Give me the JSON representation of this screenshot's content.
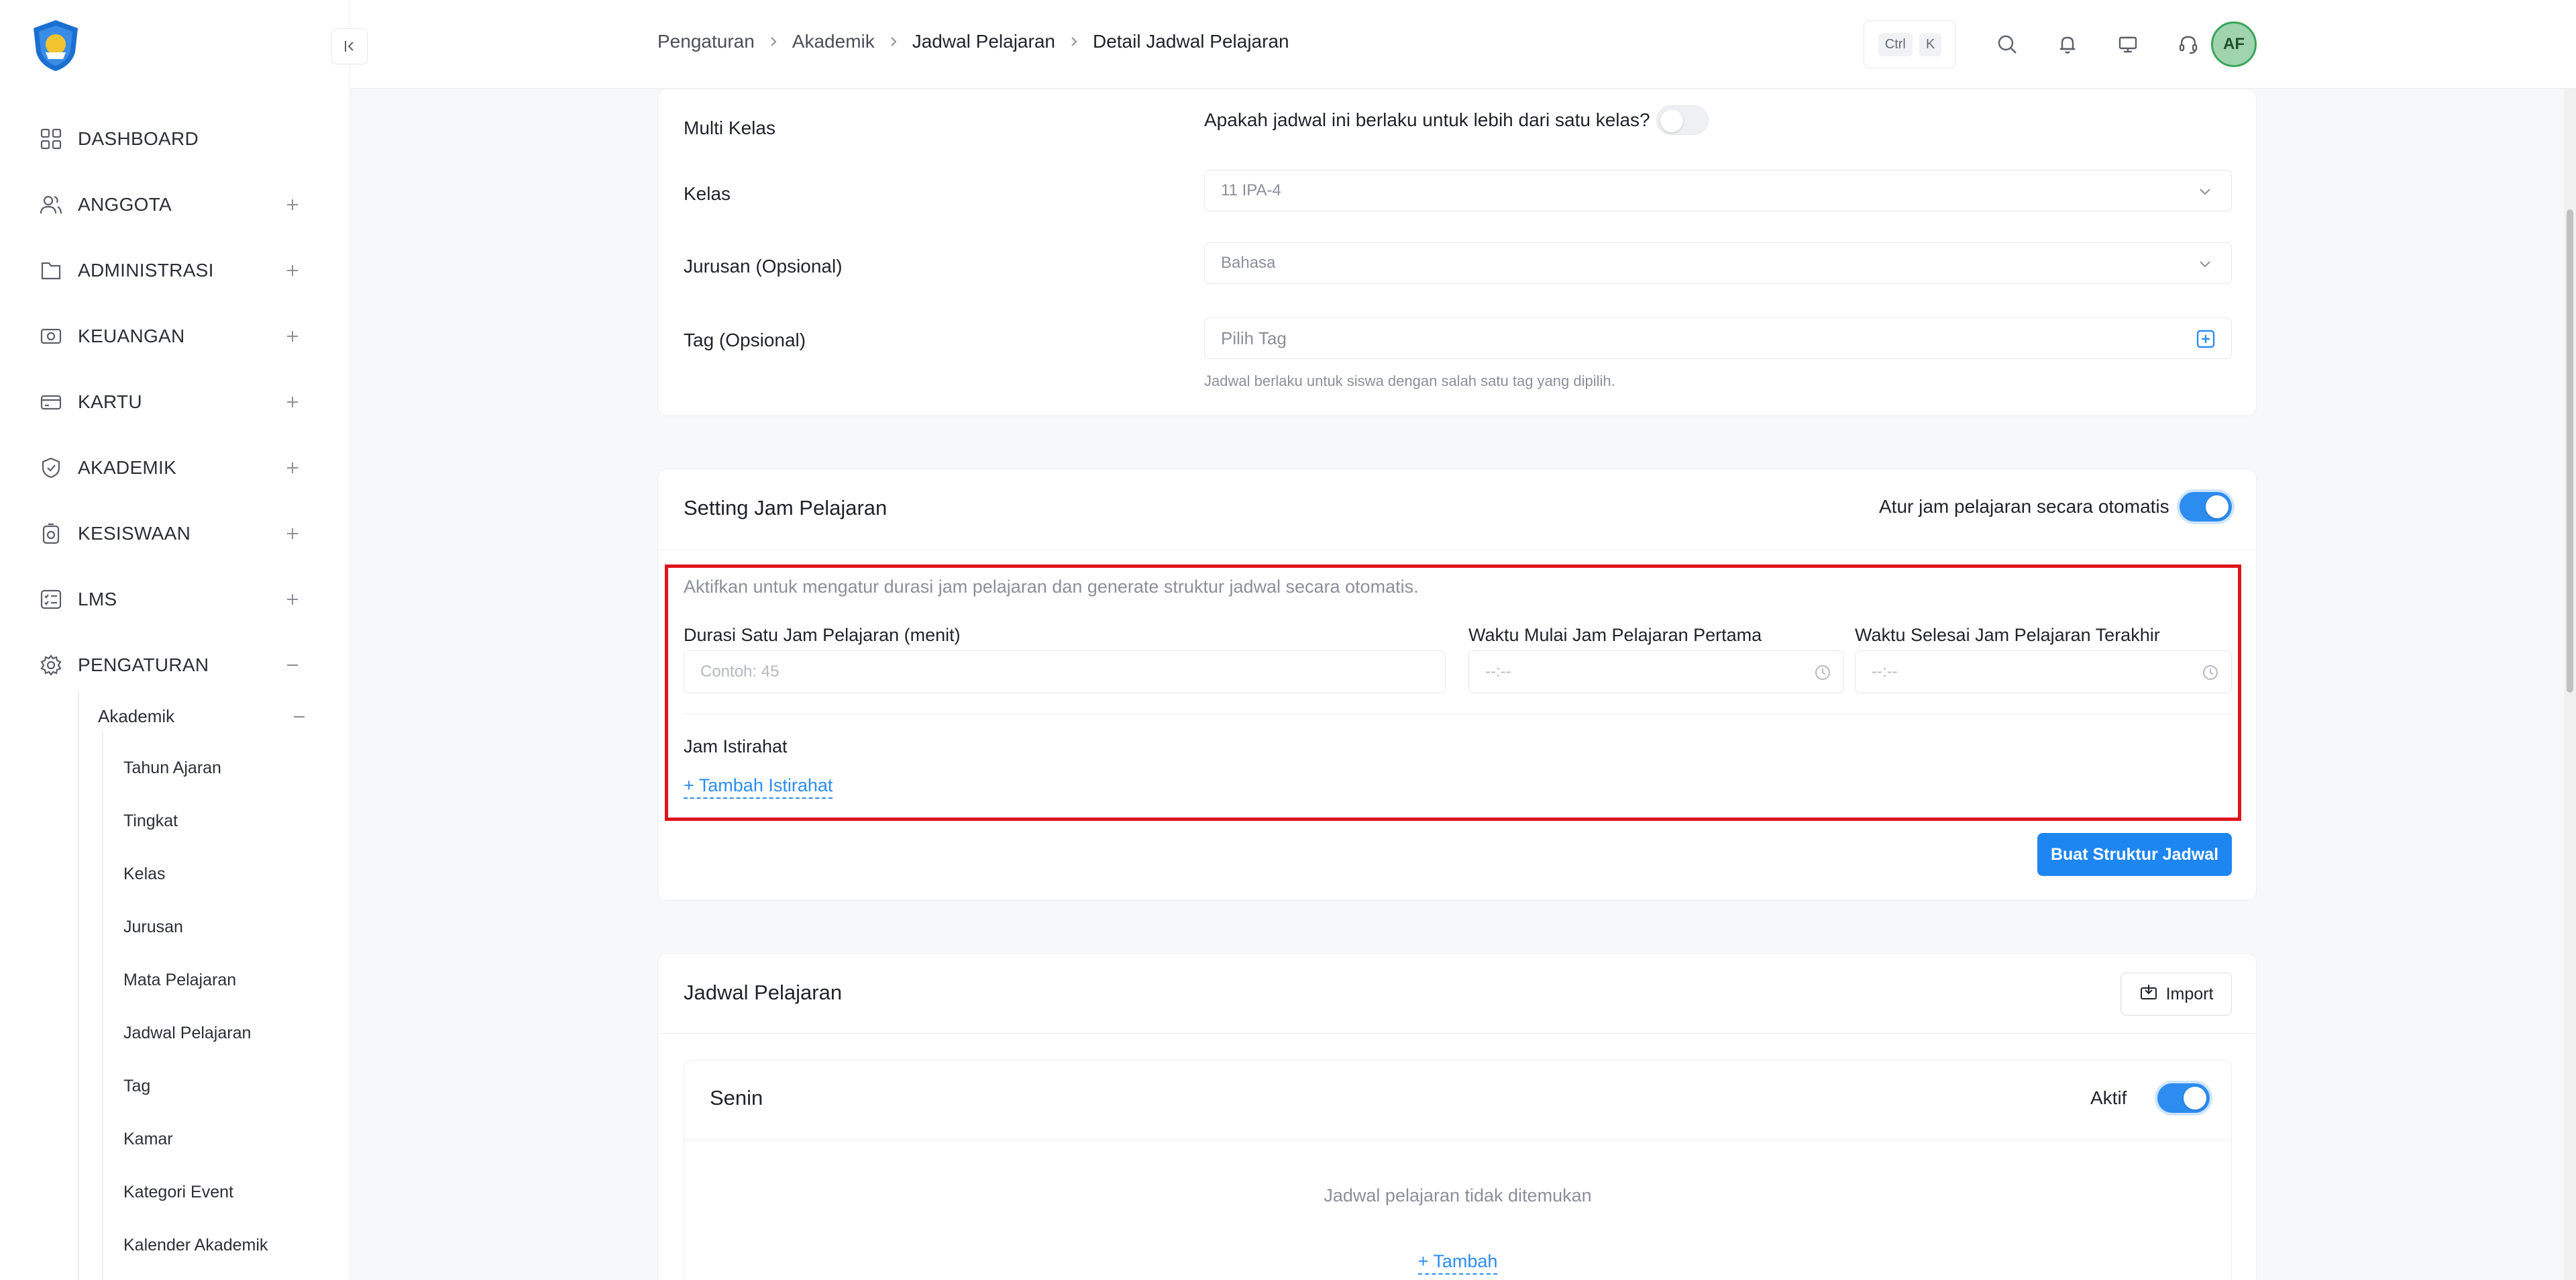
{
  "sidebar": {
    "items": [
      {
        "label": "DASHBOARD",
        "icon": "grid-icon"
      },
      {
        "label": "ANGGOTA",
        "icon": "users-icon"
      },
      {
        "label": "ADMINISTRASI",
        "icon": "folder-icon"
      },
      {
        "label": "KEUANGAN",
        "icon": "money-icon"
      },
      {
        "label": "KARTU",
        "icon": "card-icon"
      },
      {
        "label": "AKADEMIK",
        "icon": "shield-icon"
      },
      {
        "label": "KESISWAAN",
        "icon": "badge-icon"
      },
      {
        "label": "LMS",
        "icon": "checklist-icon"
      },
      {
        "label": "PENGATURAN",
        "icon": "gear-icon"
      }
    ],
    "sub_label": "Akademik",
    "sub_items": [
      "Tahun Ajaran",
      "Tingkat",
      "Kelas",
      "Jurusan",
      "Mata Pelajaran",
      "Jadwal Pelajaran",
      "Tag",
      "Kamar",
      "Kategori Event",
      "Kalender Akademik"
    ]
  },
  "header": {
    "breadcrumb": [
      "Pengaturan",
      "Akademik",
      "Jadwal Pelajaran",
      "Detail Jadwal Pelajaran"
    ],
    "kbd": [
      "Ctrl",
      "K"
    ],
    "avatar": "AF"
  },
  "form": {
    "multi_kelas_label": "Multi Kelas",
    "multi_kelas_question": "Apakah jadwal ini berlaku untuk lebih dari satu kelas?",
    "kelas_label": "Kelas",
    "kelas_value": "11 IPA-4",
    "jurusan_label": "Jurusan (Opsional)",
    "jurusan_value": "Bahasa",
    "tag_label": "Tag (Opsional)",
    "tag_placeholder": "Pilih Tag",
    "tag_hint": "Jadwal berlaku untuk siswa dengan salah satu tag yang dipilih."
  },
  "setting": {
    "title": "Setting Jam Pelajaran",
    "auto_label": "Atur jam pelajaran secara otomatis",
    "description": "Aktifkan untuk mengatur durasi jam pelajaran dan generate struktur jadwal secara otomatis.",
    "durasi_label": "Durasi Satu Jam Pelajaran (menit)",
    "durasi_placeholder": "Contoh: 45",
    "mulai_label": "Waktu Mulai Jam Pelajaran Pertama",
    "mulai_placeholder": "--:--",
    "selesai_label": "Waktu Selesai Jam Pelajaran Terakhir",
    "selesai_placeholder": "--:--",
    "istirahat_label": "Jam Istirahat",
    "add_istirahat": "+ Tambah Istirahat",
    "build_button": "Buat Struktur Jadwal"
  },
  "jadwal": {
    "title": "Jadwal Pelajaran",
    "import_label": "Import",
    "day": "Senin",
    "active_label": "Aktif",
    "empty_text": "Jadwal pelajaran tidak ditemukan",
    "add_label": "+ Tambah"
  },
  "colors": {
    "accent": "#2d8cf0",
    "highlight": "#e0141c"
  }
}
